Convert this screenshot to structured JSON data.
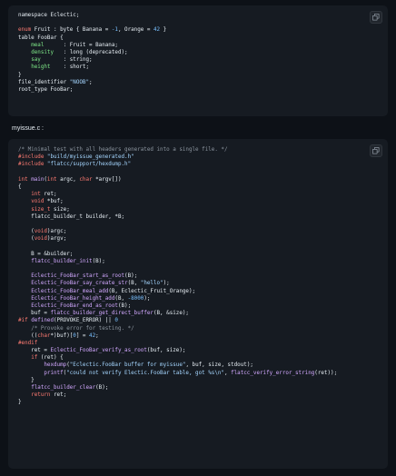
{
  "schema_block": {
    "lines": [
      [
        [
          "plain",
          "namespace Eclectic;"
        ]
      ],
      [
        [
          "plain",
          ""
        ]
      ],
      [
        [
          "kw",
          "enum"
        ],
        [
          "plain",
          " Fruit : byte { Banana = "
        ],
        [
          "num",
          "-1"
        ],
        [
          "plain",
          ", Orange = "
        ],
        [
          "num",
          "42"
        ],
        [
          "plain",
          " }"
        ]
      ],
      [
        [
          "plain",
          "table FooBar {"
        ]
      ],
      [
        [
          "plain",
          "    "
        ],
        [
          "fld",
          "meal"
        ],
        [
          "plain",
          "      : Fruit = Banana;"
        ]
      ],
      [
        [
          "plain",
          "    "
        ],
        [
          "fld",
          "density"
        ],
        [
          "plain",
          "   : long (deprecated);"
        ]
      ],
      [
        [
          "plain",
          "    "
        ],
        [
          "fld",
          "say"
        ],
        [
          "plain",
          "       : string;"
        ]
      ],
      [
        [
          "plain",
          "    "
        ],
        [
          "fld",
          "height"
        ],
        [
          "plain",
          "    : short;"
        ]
      ],
      [
        [
          "plain",
          "}"
        ]
      ],
      [
        [
          "plain",
          "file_identifier "
        ],
        [
          "str",
          "\"NOOB\""
        ],
        [
          "plain",
          ";"
        ]
      ],
      [
        [
          "plain",
          "root_type FooBar;"
        ]
      ]
    ]
  },
  "file_label": "myissue.c :",
  "c_block": {
    "lines": [
      [
        [
          "com",
          "/* Minimal test with all headers generated into a single file. */"
        ]
      ],
      [
        [
          "kw",
          "#include"
        ],
        [
          "plain",
          " "
        ],
        [
          "str",
          "\"build/myissue_generated.h\""
        ]
      ],
      [
        [
          "kw",
          "#include"
        ],
        [
          "plain",
          " "
        ],
        [
          "str",
          "\"flatcc/support/hexdump.h\""
        ]
      ],
      [
        [
          "plain",
          ""
        ]
      ],
      [
        [
          "kw",
          "int"
        ],
        [
          "plain",
          " "
        ],
        [
          "fn",
          "main"
        ],
        [
          "plain",
          "("
        ],
        [
          "kw",
          "int"
        ],
        [
          "plain",
          " argc, "
        ],
        [
          "kw",
          "char"
        ],
        [
          "plain",
          " *argv[])"
        ]
      ],
      [
        [
          "plain",
          "{"
        ]
      ],
      [
        [
          "plain",
          "    "
        ],
        [
          "kw",
          "int"
        ],
        [
          "plain",
          " ret;"
        ]
      ],
      [
        [
          "plain",
          "    "
        ],
        [
          "kw",
          "void"
        ],
        [
          "plain",
          " *buf;"
        ]
      ],
      [
        [
          "plain",
          "    "
        ],
        [
          "kw",
          "size_t"
        ],
        [
          "plain",
          " size;"
        ]
      ],
      [
        [
          "plain",
          "    flatcc_builder_t builder, *B;"
        ]
      ],
      [
        [
          "plain",
          ""
        ]
      ],
      [
        [
          "plain",
          "    ("
        ],
        [
          "kw",
          "void"
        ],
        [
          "plain",
          ")argc;"
        ]
      ],
      [
        [
          "plain",
          "    ("
        ],
        [
          "kw",
          "void"
        ],
        [
          "plain",
          ")argv;"
        ]
      ],
      [
        [
          "plain",
          ""
        ]
      ],
      [
        [
          "plain",
          "    B = &builder;"
        ]
      ],
      [
        [
          "plain",
          "    "
        ],
        [
          "fn",
          "flatcc_builder_init"
        ],
        [
          "plain",
          "(B);"
        ]
      ],
      [
        [
          "plain",
          ""
        ]
      ],
      [
        [
          "plain",
          "    "
        ],
        [
          "fn",
          "Eclectic_FooBar_start_as_root"
        ],
        [
          "plain",
          "(B);"
        ]
      ],
      [
        [
          "plain",
          "    "
        ],
        [
          "fn",
          "Eclectic_FooBar_say_create_str"
        ],
        [
          "plain",
          "(B, "
        ],
        [
          "str",
          "\"hello\""
        ],
        [
          "plain",
          ");"
        ]
      ],
      [
        [
          "plain",
          "    "
        ],
        [
          "fn",
          "Eclectic_FooBar_meal_add"
        ],
        [
          "plain",
          "(B, Eclectic_Fruit_Orange);"
        ]
      ],
      [
        [
          "plain",
          "    "
        ],
        [
          "fn",
          "Eclectic_FooBar_height_add"
        ],
        [
          "plain",
          "(B, "
        ],
        [
          "num",
          "-8000"
        ],
        [
          "plain",
          ");"
        ]
      ],
      [
        [
          "plain",
          "    "
        ],
        [
          "fn",
          "Eclectic_FooBar_end_as_root"
        ],
        [
          "plain",
          "(B);"
        ]
      ],
      [
        [
          "plain",
          "    buf = "
        ],
        [
          "fn",
          "flatcc_builder_get_direct_buffer"
        ],
        [
          "plain",
          "(B, &size);"
        ]
      ],
      [
        [
          "kw",
          "#if"
        ],
        [
          "plain",
          " "
        ],
        [
          "fn",
          "defined"
        ],
        [
          "plain",
          "(PROVOKE_ERROR) || "
        ],
        [
          "num",
          "0"
        ]
      ],
      [
        [
          "plain",
          "    "
        ],
        [
          "com",
          "/* Provoke error for testing. */"
        ]
      ],
      [
        [
          "plain",
          "    (("
        ],
        [
          "kw",
          "char"
        ],
        [
          "plain",
          "*)buf)["
        ],
        [
          "num",
          "0"
        ],
        [
          "plain",
          "] = "
        ],
        [
          "num",
          "42"
        ],
        [
          "plain",
          ";"
        ]
      ],
      [
        [
          "kw",
          "#endif"
        ]
      ],
      [
        [
          "plain",
          "    ret = "
        ],
        [
          "fn",
          "Eclectic_FooBar_verify_as_root"
        ],
        [
          "plain",
          "(buf, size);"
        ]
      ],
      [
        [
          "plain",
          "    "
        ],
        [
          "kw",
          "if"
        ],
        [
          "plain",
          " (ret) {"
        ]
      ],
      [
        [
          "plain",
          "        "
        ],
        [
          "fn",
          "hexdump"
        ],
        [
          "plain",
          "("
        ],
        [
          "str",
          "\"Eclectic.FooBar buffer for myissue\""
        ],
        [
          "plain",
          ", buf, size, stdout);"
        ]
      ],
      [
        [
          "plain",
          "        "
        ],
        [
          "fn",
          "printf"
        ],
        [
          "plain",
          "("
        ],
        [
          "str",
          "\"could not verify Electic.FooBar table, got %s\\n\""
        ],
        [
          "plain",
          ", "
        ],
        [
          "fn",
          "flatcc_verify_error_string"
        ],
        [
          "plain",
          "(ret));"
        ]
      ],
      [
        [
          "plain",
          "    }"
        ]
      ],
      [
        [
          "plain",
          "    "
        ],
        [
          "fn",
          "flatcc_builder_clear"
        ],
        [
          "plain",
          "(B);"
        ]
      ],
      [
        [
          "plain",
          "    "
        ],
        [
          "kw",
          "return"
        ],
        [
          "plain",
          " ret;"
        ]
      ],
      [
        [
          "plain",
          "}"
        ]
      ]
    ]
  }
}
